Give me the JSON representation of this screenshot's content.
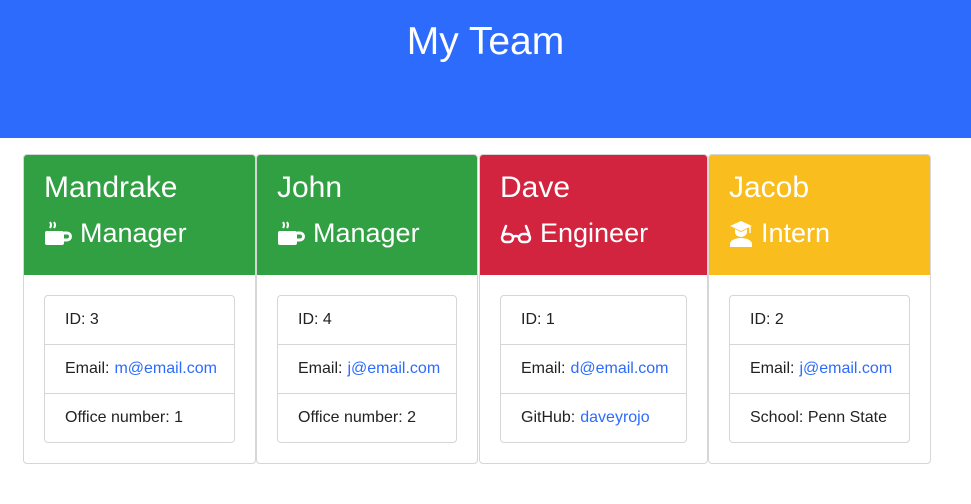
{
  "header": {
    "title": "My Team"
  },
  "colors": {
    "header": "#2d6bfc",
    "manager": "#30a042",
    "engineer": "#d3243f",
    "intern": "#f9bd1e",
    "link": "#2d6bfc"
  },
  "cards": [
    {
      "name": "Mandrake",
      "role": "Manager",
      "icon": "coffee-mug-icon",
      "id_label": "ID: 3",
      "email_label": "Email:",
      "email": "m@email.com",
      "extra_label": "Office number: 1",
      "extra_link": ""
    },
    {
      "name": "John",
      "role": "Manager",
      "icon": "coffee-mug-icon",
      "id_label": "ID: 4",
      "email_label": "Email:",
      "email": "j@email.com",
      "extra_label": "Office number: 2",
      "extra_link": ""
    },
    {
      "name": "Dave",
      "role": "Engineer",
      "icon": "glasses-icon",
      "id_label": "ID: 1",
      "email_label": "Email:",
      "email": "d@email.com",
      "extra_label": "GitHub:",
      "extra_link": "daveyrojo"
    },
    {
      "name": "Jacob",
      "role": "Intern",
      "icon": "graduate-icon",
      "id_label": "ID: 2",
      "email_label": "Email:",
      "email": "j@email.com",
      "extra_label": "School: Penn State",
      "extra_link": ""
    }
  ]
}
